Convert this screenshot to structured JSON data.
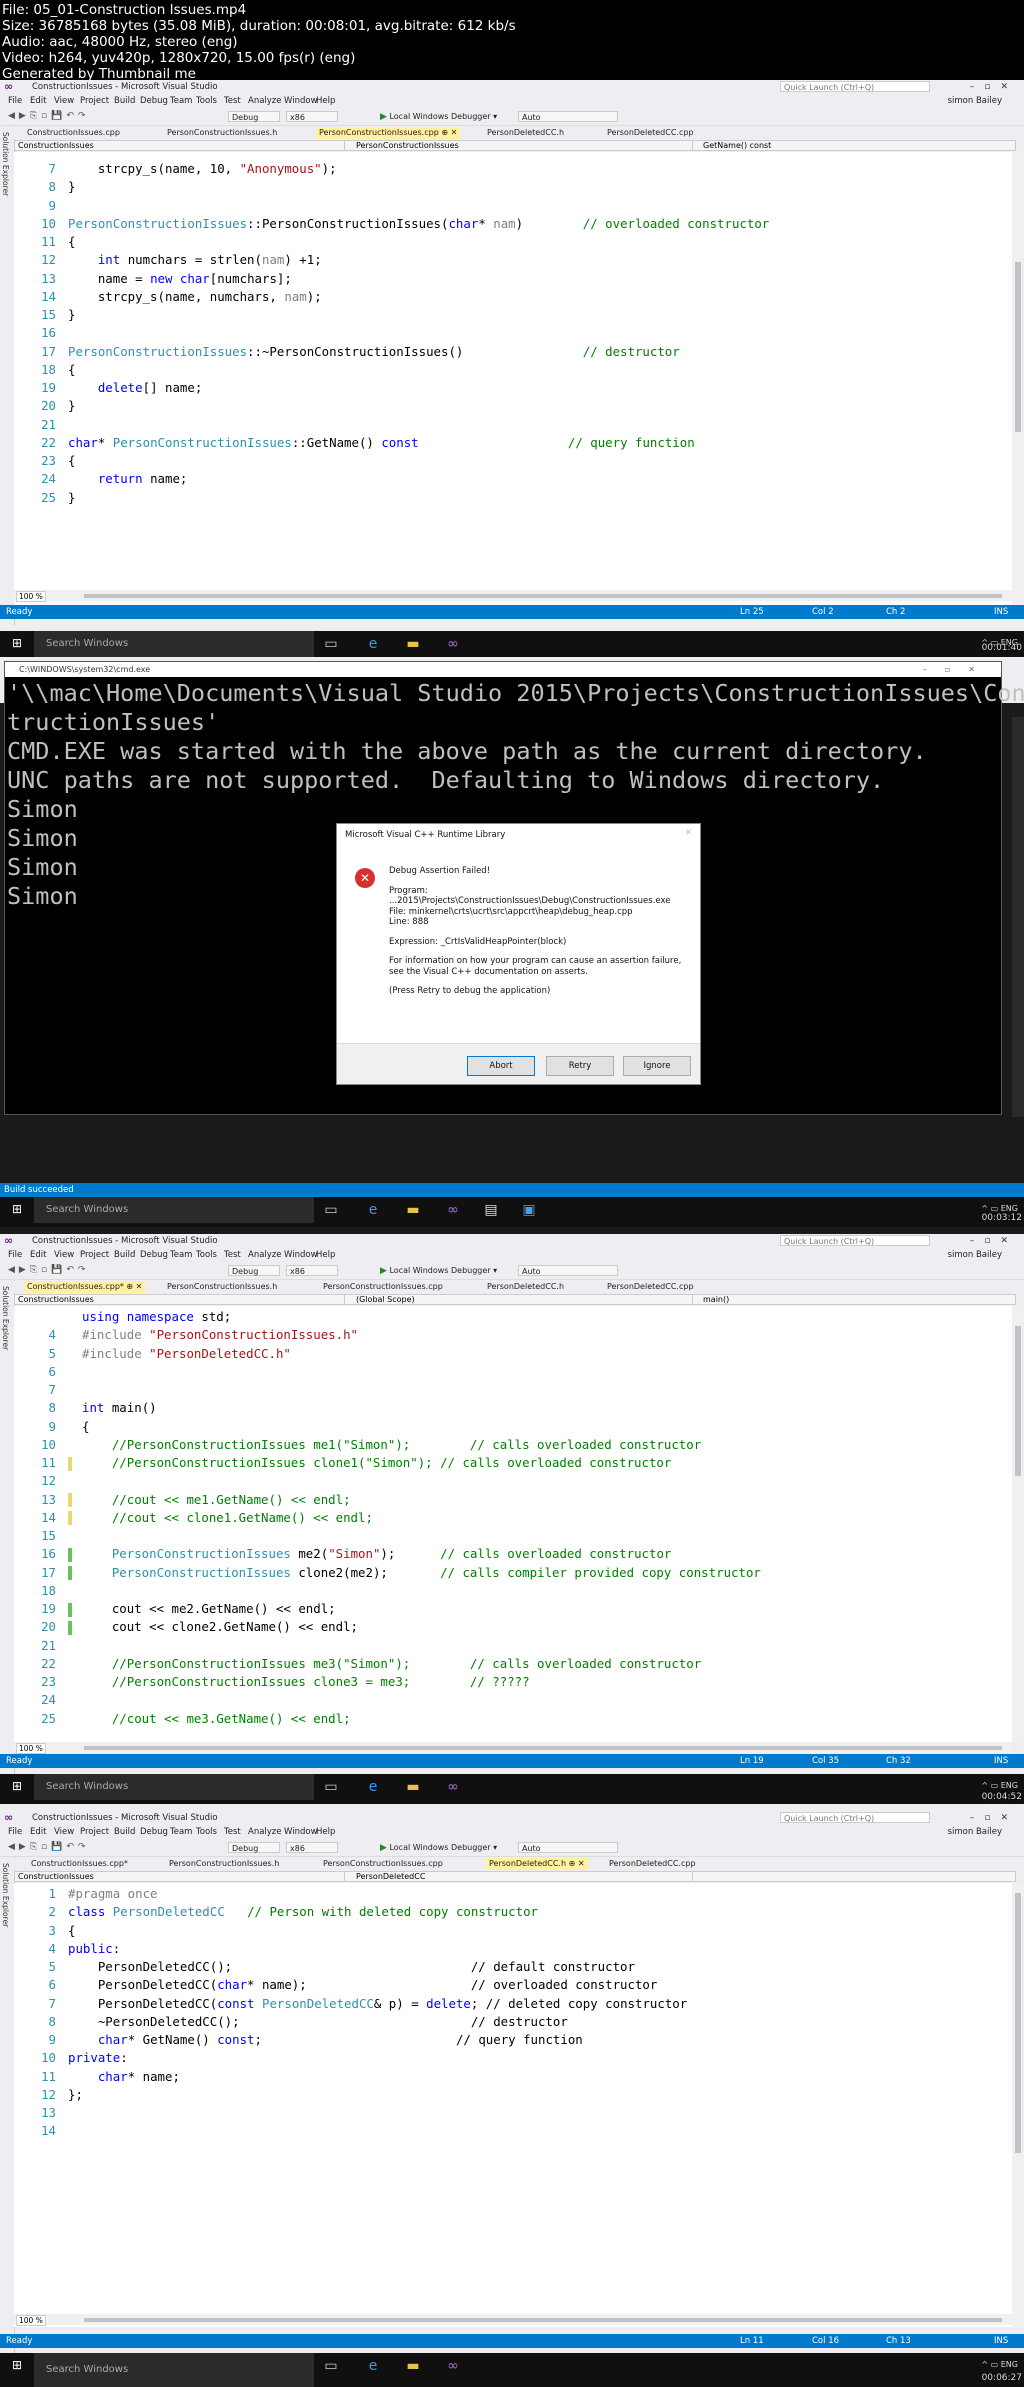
{
  "file_info": [
    "File: 05_01-Construction Issues.mp4",
    "Size: 36785168 bytes (35.08 MiB), duration: 00:08:01, avg.bitrate: 612 kb/s",
    "Audio: aac, 48000 Hz, stereo (eng)",
    "Video: h264, yuv420p, 1280x720, 15.00 fps(r) (eng)",
    "Generated by Thumbnail me"
  ],
  "vs": {
    "title": "ConstructionIssues - Microsoft Visual Studio",
    "quick_launch": "Quick Launch (Ctrl+Q)",
    "user": "simon Bailey",
    "menu": [
      "File",
      "Edit",
      "View",
      "Project",
      "Build",
      "Debug",
      "Team",
      "Tools",
      "Test",
      "Analyze",
      "Window",
      "Help"
    ],
    "config": "Debug",
    "platform": "x86",
    "debugger": "Local Windows Debugger",
    "auto": "Auto",
    "solution_explorer": "Solution Explorer",
    "zoom": "100 %",
    "ready": "Ready"
  },
  "frames": [
    {
      "timestamp": "00:01:40",
      "tabs": [
        "ConstructionIssues.cpp",
        "PersonConstructionIssues.h",
        "PersonConstructionIssues.cpp",
        "PersonDeletedCC.h",
        "PersonDeletedCC.cpp"
      ],
      "active_tab": 2,
      "nav": [
        "ConstructionIssues",
        "PersonConstructionIssues",
        "GetName() const"
      ],
      "status": {
        "ln": "Ln 25",
        "col": "Col 2",
        "ch": "Ch 2",
        "mode": "INS"
      }
    },
    {
      "timestamp": "00:03:12",
      "cmd_title": "C:\\WINDOWS\\system32\\cmd.exe",
      "cmd_lines": [
        "'\\\\mac\\Home\\Documents\\Visual Studio 2015\\Projects\\ConstructionIssues\\Cons",
        "tructionIssues'",
        "CMD.EXE was started with the above path as the current directory.",
        "UNC paths are not supported.  Defaulting to Windows directory.",
        "Simon",
        "Simon",
        "Simon",
        "Simon"
      ],
      "dialog": {
        "title": "Microsoft Visual C++ Runtime Library",
        "heading": "Debug Assertion Failed!",
        "program_label": "Program:",
        "program": "...2015\\Projects\\ConstructionIssues\\Debug\\ConstructionIssues.exe",
        "file": "File: minkernel\\crts\\ucrt\\src\\appcrt\\heap\\debug_heap.cpp",
        "line": "Line: 888",
        "expression": "Expression: _CrtIsValidHeapPointer(block)",
        "info": "For information on how your program can cause an assertion failure, see the Visual C++ documentation on asserts.",
        "press": "(Press Retry to debug the application)",
        "buttons": [
          "Abort",
          "Retry",
          "Ignore"
        ]
      },
      "status_text": "Build succeeded"
    },
    {
      "timestamp": "00:04:52",
      "tabs": [
        "ConstructionIssues.cpp*",
        "PersonConstructionIssues.h",
        "PersonConstructionIssues.cpp",
        "PersonDeletedCC.h",
        "PersonDeletedCC.cpp"
      ],
      "active_tab": 0,
      "nav": [
        "ConstructionIssues",
        "(Global Scope)",
        "main()"
      ],
      "status": {
        "ln": "Ln 19",
        "col": "Col 35",
        "ch": "Ch 32",
        "mode": "INS"
      }
    },
    {
      "timestamp": "00:06:27",
      "tabs": [
        "ConstructionIssues.cpp*",
        "PersonConstructionIssues.h",
        "PersonConstructionIssues.cpp",
        "PersonDeletedCC.h",
        "PersonDeletedCC.cpp"
      ],
      "active_tab": 3,
      "nav": [
        "ConstructionIssues",
        "PersonDeletedCC",
        ""
      ],
      "status": {
        "ln": "Ln 11",
        "col": "Col 16",
        "ch": "Ch 13",
        "mode": "INS"
      }
    }
  ],
  "taskbar": {
    "search": "Search Windows",
    "lang": "ENG"
  },
  "code1": [
    {
      "n": "7",
      "t": [
        [
          "",
          "    strcpy_s(name, 10, "
        ],
        [
          "str",
          "\"Anonymous\""
        ],
        [
          "",
          ");"
        ]
      ]
    },
    {
      "n": "8",
      "t": [
        [
          "",
          "}"
        ]
      ]
    },
    {
      "n": "9",
      "t": []
    },
    {
      "n": "10",
      "t": [
        [
          "ty",
          "PersonConstructionIssues"
        ],
        [
          "",
          "::PersonConstructionIssues("
        ],
        [
          "kw",
          "char"
        ],
        [
          "",
          "* "
        ],
        [
          "par",
          "nam"
        ],
        [
          "",
          ")        "
        ],
        [
          "cm",
          "// overloaded constructor"
        ]
      ]
    },
    {
      "n": "11",
      "t": [
        [
          "",
          "{"
        ]
      ]
    },
    {
      "n": "12",
      "t": [
        [
          "",
          "    "
        ],
        [
          "kw",
          "int"
        ],
        [
          "",
          " numchars = strlen("
        ],
        [
          "par",
          "nam"
        ],
        [
          "",
          ") +1;"
        ]
      ]
    },
    {
      "n": "13",
      "t": [
        [
          "",
          "    name = "
        ],
        [
          "kw",
          "new"
        ],
        [
          "",
          " "
        ],
        [
          "kw",
          "char"
        ],
        [
          "",
          "[numchars];"
        ]
      ]
    },
    {
      "n": "14",
      "t": [
        [
          "",
          "    strcpy_s(name, numchars, "
        ],
        [
          "par",
          "nam"
        ],
        [
          "",
          ");"
        ]
      ]
    },
    {
      "n": "15",
      "t": [
        [
          "",
          "}"
        ]
      ]
    },
    {
      "n": "16",
      "t": []
    },
    {
      "n": "17",
      "t": [
        [
          "ty",
          "PersonConstructionIssues"
        ],
        [
          "",
          "::~PersonConstructionIssues()                "
        ],
        [
          "cm",
          "// destructor"
        ]
      ]
    },
    {
      "n": "18",
      "t": [
        [
          "",
          "{"
        ]
      ]
    },
    {
      "n": "19",
      "t": [
        [
          "",
          "    "
        ],
        [
          "kw",
          "delete"
        ],
        [
          "",
          "[] name;"
        ]
      ]
    },
    {
      "n": "20",
      "t": [
        [
          "",
          "}"
        ]
      ]
    },
    {
      "n": "21",
      "t": []
    },
    {
      "n": "22",
      "t": [
        [
          "kw",
          "char"
        ],
        [
          "",
          "* "
        ],
        [
          "ty",
          "PersonConstructionIssues"
        ],
        [
          "",
          "::GetName() "
        ],
        [
          "kw",
          "const"
        ],
        [
          "",
          "                    "
        ],
        [
          "cm",
          "// query function"
        ]
      ]
    },
    {
      "n": "23",
      "t": [
        [
          "",
          "{"
        ]
      ]
    },
    {
      "n": "24",
      "t": [
        [
          "",
          "    "
        ],
        [
          "kw",
          "return"
        ],
        [
          "",
          " name;"
        ]
      ]
    },
    {
      "n": "25",
      "t": [
        [
          "",
          "}"
        ]
      ]
    }
  ],
  "code3": [
    {
      "n": "",
      "g": "",
      "t": [
        [
          "kw",
          "using namespace"
        ],
        [
          "",
          " std;"
        ]
      ]
    },
    {
      "n": "4",
      "g": "",
      "t": [
        [
          "pp",
          "#include "
        ],
        [
          "str",
          "\"PersonConstructionIssues.h\""
        ]
      ]
    },
    {
      "n": "5",
      "g": "",
      "t": [
        [
          "pp",
          "#include "
        ],
        [
          "str",
          "\"PersonDeletedCC.h\""
        ]
      ]
    },
    {
      "n": "6",
      "g": "",
      "t": []
    },
    {
      "n": "7",
      "g": "",
      "t": []
    },
    {
      "n": "8",
      "g": "",
      "t": [
        [
          "kw",
          "int"
        ],
        [
          "",
          " main()"
        ]
      ]
    },
    {
      "n": "9",
      "g": "",
      "t": [
        [
          "",
          "{"
        ]
      ]
    },
    {
      "n": "10",
      "g": "",
      "t": [
        [
          "",
          "    "
        ],
        [
          "cm",
          "//PersonConstructionIssues me1(\"Simon\");        // calls overloaded constructor"
        ]
      ]
    },
    {
      "n": "11",
      "g": "y",
      "t": [
        [
          "",
          "    "
        ],
        [
          "cm",
          "//PersonConstructionIssues clone1(\"Simon\"); // calls overloaded constructor"
        ]
      ]
    },
    {
      "n": "12",
      "g": "",
      "t": []
    },
    {
      "n": "13",
      "g": "y",
      "t": [
        [
          "",
          "    "
        ],
        [
          "cm",
          "//cout << me1.GetName() << endl;"
        ]
      ]
    },
    {
      "n": "14",
      "g": "y",
      "t": [
        [
          "",
          "    "
        ],
        [
          "cm",
          "//cout << clone1.GetName() << endl;"
        ]
      ]
    },
    {
      "n": "15",
      "g": "",
      "t": []
    },
    {
      "n": "16",
      "g": "g",
      "t": [
        [
          "",
          "    "
        ],
        [
          "ty",
          "PersonConstructionIssues"
        ],
        [
          "",
          " me2("
        ],
        [
          "str",
          "\"Simon\""
        ],
        [
          "",
          ");      "
        ],
        [
          "cm",
          "// calls overloaded constructor"
        ]
      ]
    },
    {
      "n": "17",
      "g": "g",
      "t": [
        [
          "",
          "    "
        ],
        [
          "ty",
          "PersonConstructionIssues"
        ],
        [
          "",
          " clone2(me2);       "
        ],
        [
          "cm",
          "// calls compiler provided copy constructor"
        ]
      ]
    },
    {
      "n": "18",
      "g": "",
      "t": []
    },
    {
      "n": "19",
      "g": "g",
      "t": [
        [
          "",
          "    cout << me2.GetName() << endl;"
        ]
      ]
    },
    {
      "n": "20",
      "g": "g",
      "t": [
        [
          "",
          "    cout << clone2.GetName() << endl;"
        ]
      ]
    },
    {
      "n": "21",
      "g": "",
      "t": []
    },
    {
      "n": "22",
      "g": "",
      "t": [
        [
          "",
          "    "
        ],
        [
          "cm",
          "//PersonConstructionIssues me3(\"Simon\");        // calls overloaded constructor"
        ]
      ]
    },
    {
      "n": "23",
      "g": "",
      "t": [
        [
          "",
          "    "
        ],
        [
          "cm",
          "//PersonConstructionIssues clone3 = me3;        // ?????"
        ]
      ]
    },
    {
      "n": "24",
      "g": "",
      "t": []
    },
    {
      "n": "25",
      "g": "",
      "t": [
        [
          "",
          "    "
        ],
        [
          "cm",
          "//cout << me3.GetName() << endl;"
        ]
      ]
    }
  ],
  "code4": [
    {
      "n": "1",
      "t": [
        [
          "pp",
          "#pragma once"
        ]
      ]
    },
    {
      "n": "2",
      "t": [
        [
          "kw",
          "class"
        ],
        [
          "",
          " "
        ],
        [
          "ty",
          "PersonDeletedCC"
        ],
        [
          "",
          "   "
        ],
        [
          "cm",
          "// Person with deleted copy constructor"
        ]
      ]
    },
    {
      "n": "3",
      "t": [
        [
          "",
          "{"
        ]
      ]
    },
    {
      "n": "4",
      "t": [
        [
          "kw",
          "public"
        ],
        [
          "",
          ":"
        ]
      ]
    },
    {
      "n": "5",
      "t": [
        [
          "",
          "    PersonDeletedCC();                                // default constructor"
        ]
      ]
    },
    {
      "n": "6",
      "t": [
        [
          "",
          "    PersonDeletedCC("
        ],
        [
          "kw",
          "char"
        ],
        [
          "",
          "* name);                      // overloaded constructor"
        ]
      ]
    },
    {
      "n": "7",
      "t": [
        [
          "",
          "    PersonDeletedCC("
        ],
        [
          "kw",
          "const"
        ],
        [
          "",
          " "
        ],
        [
          "ty",
          "PersonDeletedCC"
        ],
        [
          "",
          "& p) = "
        ],
        [
          "kw",
          "delete"
        ],
        [
          "",
          "; // deleted copy constructor"
        ]
      ]
    },
    {
      "n": "8",
      "t": [
        [
          "",
          "    ~PersonDeletedCC();                               // destructor"
        ]
      ]
    },
    {
      "n": "9",
      "t": [
        [
          "",
          "    "
        ],
        [
          "kw",
          "char"
        ],
        [
          "",
          "* GetName() "
        ],
        [
          "kw",
          "const"
        ],
        [
          "",
          ";                          // query function"
        ]
      ]
    },
    {
      "n": "10",
      "t": [
        [
          "kw",
          "private"
        ],
        [
          "",
          ":"
        ]
      ]
    },
    {
      "n": "11",
      "t": [
        [
          "",
          "    "
        ],
        [
          "kw",
          "char"
        ],
        [
          "",
          "* name;"
        ]
      ]
    },
    {
      "n": "12",
      "t": [
        [
          "",
          "};"
        ]
      ]
    },
    {
      "n": "13",
      "t": []
    },
    {
      "n": "14",
      "t": []
    }
  ]
}
